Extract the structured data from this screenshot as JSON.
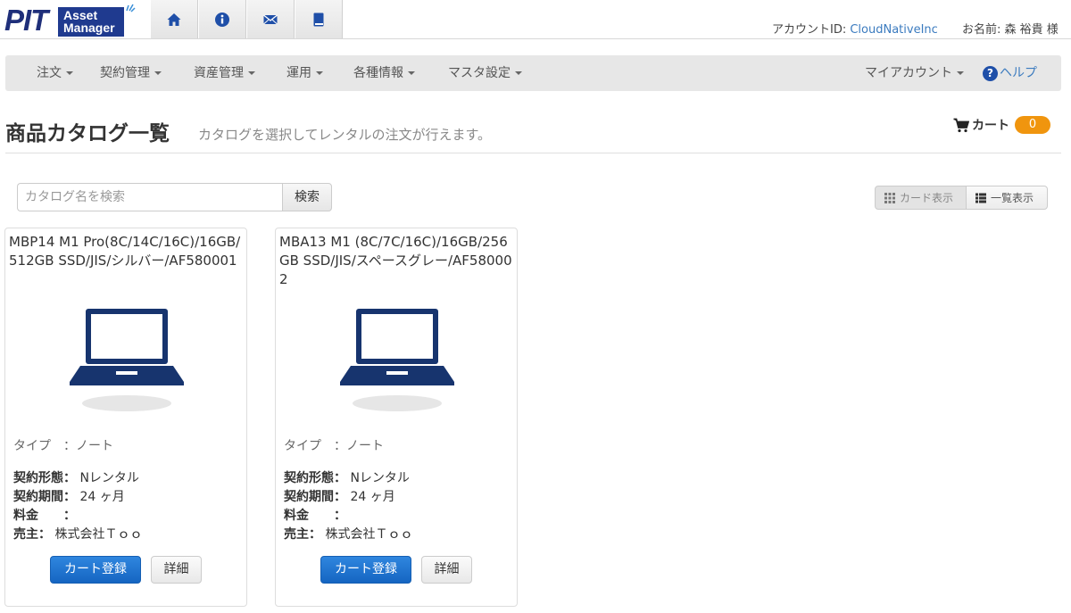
{
  "brand": {
    "logo_main": "PIT",
    "logo_sub_1": "Asset",
    "logo_sub_2": "Manager",
    "accent_color": "#1f3a8f"
  },
  "top_icons": [
    "home-icon",
    "info-icon",
    "mail-icon",
    "book-icon"
  ],
  "account": {
    "id_label": "アカウントID: ",
    "id_value": "CloudNativeInc",
    "name_label": "お名前: 森 裕貴 様"
  },
  "menu": {
    "items": [
      "注文",
      "契約管理",
      "資産管理",
      "運用",
      "各種情報",
      "マスタ設定"
    ],
    "my_account": "マイアカウント",
    "help": "ヘルプ"
  },
  "page": {
    "title": "商品カタログ一覧",
    "subtitle": "カタログを選択してレンタルの注文が行えます。"
  },
  "cart": {
    "label": "カート",
    "count": "0",
    "badge_color": "#f0950e"
  },
  "search": {
    "placeholder": "カタログ名を検索",
    "button": "検索"
  },
  "view": {
    "card": "カード表示",
    "list": "一覧表示"
  },
  "catalog": [
    {
      "title": "MBP14 M1 Pro(8C/14C/16C)/16GB/512GB SSD/JIS/シルバー/AF580001",
      "type_label": "タイプ　：",
      "type_value": "ノート",
      "contract_label": "契約形態：",
      "contract_value": "Nレンタル",
      "period_label": "契約期間：",
      "period_value": "24 ヶ月",
      "price_label": "料金　　：",
      "price_value": "",
      "seller_label": "売主：",
      "seller_value": "株式会社Ｔｏｏ",
      "cart_button": "カート登録",
      "detail_button": "詳細"
    },
    {
      "title": "MBA13 M1 (8C/7C/16C)/16GB/256GB SSD/JIS/スペースグレー/AF580002",
      "type_label": "タイプ　：",
      "type_value": "ノート",
      "contract_label": "契約形態：",
      "contract_value": "Nレンタル",
      "period_label": "契約期間：",
      "period_value": "24 ヶ月",
      "price_label": "料金　　：",
      "price_value": "",
      "seller_label": "売主：",
      "seller_value": "株式会社Ｔｏｏ",
      "cart_button": "カート登録",
      "detail_button": "詳細"
    }
  ]
}
